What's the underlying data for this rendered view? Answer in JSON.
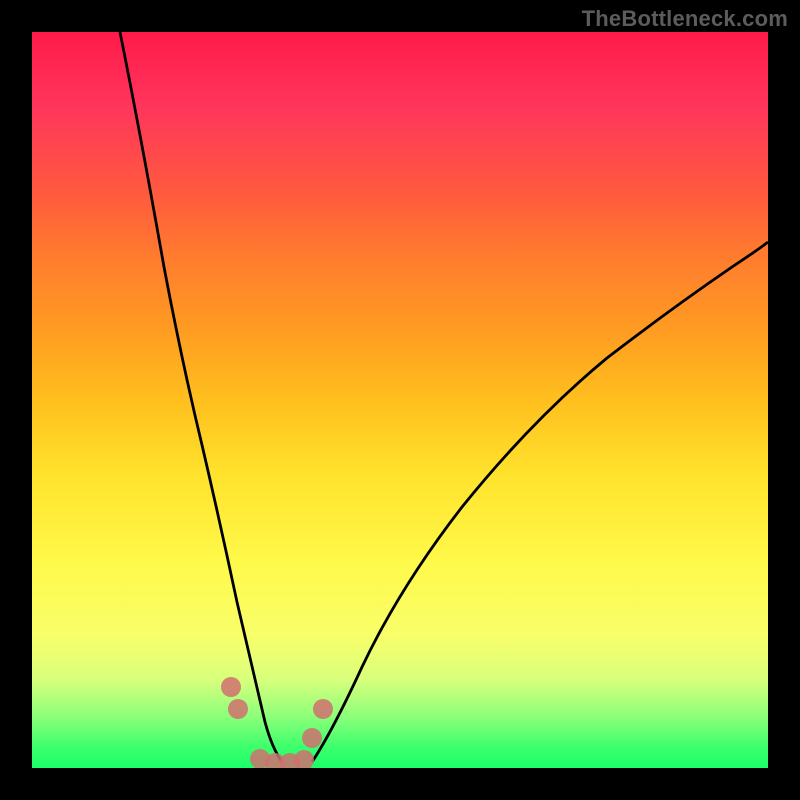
{
  "watermark": "TheBottleneck.com",
  "chart_data": {
    "type": "line",
    "title": "",
    "xlabel": "",
    "ylabel": "",
    "xlim": [
      0,
      100
    ],
    "ylim": [
      0,
      100
    ],
    "background_gradient": {
      "top_color": "#ff1a4a",
      "mid_color": "#fff94a",
      "bottom_color": "#1aff6a",
      "semantics": "bottleneck-severity-heatmap"
    },
    "series": [
      {
        "name": "left-branch",
        "x": [
          12,
          14,
          16,
          18,
          20,
          22,
          24,
          26,
          27.5,
          29,
          30.5,
          32
        ],
        "values": [
          100,
          89,
          78,
          67,
          57,
          47,
          37,
          27,
          19,
          12,
          6,
          1
        ]
      },
      {
        "name": "right-branch",
        "x": [
          38,
          40,
          43,
          47,
          52,
          58,
          65,
          72,
          80,
          88,
          96,
          100
        ],
        "values": [
          1,
          6,
          13,
          21,
          30,
          39,
          48,
          55,
          62,
          68,
          73,
          76
        ]
      },
      {
        "name": "valley-markers",
        "type": "scatter",
        "x": [
          27,
          28,
          31,
          33,
          35,
          37,
          38,
          39.5
        ],
        "values": [
          11,
          8,
          1,
          0.5,
          0.5,
          1,
          4,
          8
        ]
      }
    ],
    "colors": {
      "curve": "#000000",
      "markers": "#d07070"
    }
  }
}
